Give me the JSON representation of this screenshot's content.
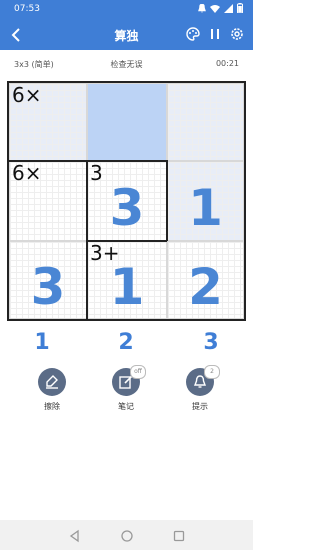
{
  "status_bar": {
    "time": "07:53"
  },
  "header": {
    "title": "算独"
  },
  "info": {
    "level": "3x3 (简单)",
    "status": "检查无误",
    "timer": "00:21"
  },
  "board": {
    "cells": [
      {
        "cage": "6×",
        "value": ""
      },
      {
        "cage": "",
        "value": ""
      },
      {
        "cage": "",
        "value": ""
      },
      {
        "cage": "6×",
        "value": ""
      },
      {
        "cage": "3",
        "value": "3"
      },
      {
        "cage": "",
        "value": "1"
      },
      {
        "cage": "",
        "value": "3"
      },
      {
        "cage": "3+",
        "value": "1"
      },
      {
        "cage": "",
        "value": "2"
      }
    ]
  },
  "numpad": [
    "1",
    "2",
    "3"
  ],
  "tools": {
    "erase_label": "擦除",
    "notes_label": "笔记",
    "notes_badge": "off",
    "hint_label": "提示",
    "hint_badge": "2"
  },
  "colors": {
    "primary": "#3f7ed6",
    "value": "#4a86d4",
    "selected": "#bcd3f5",
    "tool": "#5b6c87"
  }
}
